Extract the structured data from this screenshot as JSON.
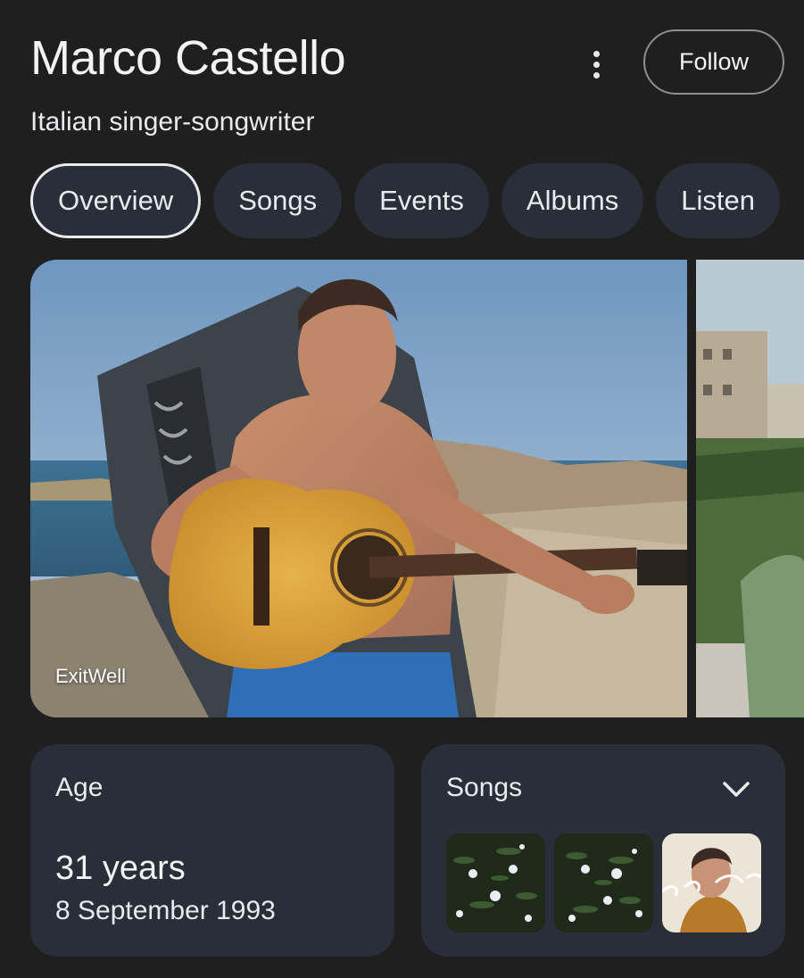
{
  "header": {
    "title": "Marco Castello",
    "subtitle": "Italian singer-songwriter",
    "follow_label": "Follow",
    "more_icon": "more-vert-icon"
  },
  "tabs": [
    {
      "label": "Overview",
      "active": true
    },
    {
      "label": "Songs",
      "active": false
    },
    {
      "label": "Events",
      "active": false
    },
    {
      "label": "Albums",
      "active": false
    },
    {
      "label": "Listen",
      "active": false
    }
  ],
  "images": {
    "main_credit": "ExitWell"
  },
  "age_card": {
    "label": "Age",
    "value": "31 years",
    "birth_date": "8 September 1993"
  },
  "songs_card": {
    "label": "Songs",
    "expand_icon": "chevron-down-icon"
  },
  "colors": {
    "background": "#1f1f1f",
    "chip": "#2a2e38",
    "text": "#e8eaed"
  }
}
